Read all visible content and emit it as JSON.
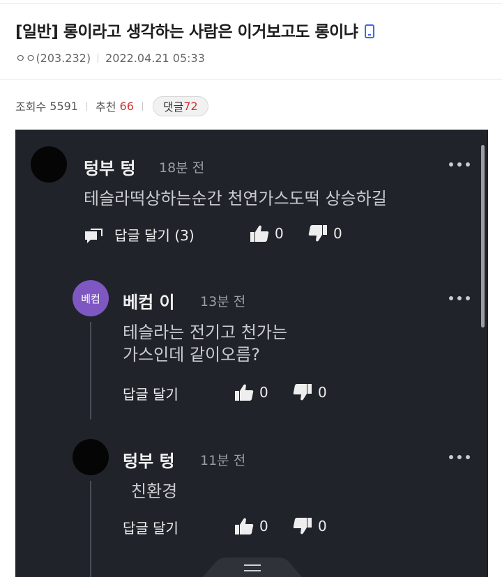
{
  "post": {
    "title": "[일반] 롱이라고 생각하는 사람은 이거보고도 롱이냐",
    "author": "ㅇㅇ(203.232)",
    "datetime": "2022.04.21 05:33",
    "views_label": "조회수",
    "views": "5591",
    "recommend_label": "추천",
    "recommend": "66",
    "comments_label": "댓글",
    "comments": "72"
  },
  "comments": [
    {
      "name": "텅부 텅",
      "time": "18분 전",
      "lines": [
        "테슬라떡상하는순간 천연가스도떡 상승하길"
      ],
      "reply_label": "답글 달기 (3)",
      "likes": "0",
      "dislikes": "0"
    },
    {
      "avatar_text": "베컴",
      "name": "베컴 이",
      "time": "13분 전",
      "lines": [
        "테슬라는 전기고 천가는",
        "가스인데 같이오름?"
      ],
      "reply_label": "답글 달기",
      "likes": "0",
      "dislikes": "0"
    },
    {
      "name": "텅부 텅",
      "time": "11분 전",
      "lines": [
        "친환경"
      ],
      "reply_label": "답글 달기",
      "likes": "0",
      "dislikes": "0"
    }
  ],
  "colors": {
    "recommend_accent": "#c73535",
    "dark_background": "#20242a",
    "avatar_purple": "#7f57c2",
    "mobile_icon": "#3d6be0"
  },
  "icons": [
    "mobile-phone-icon",
    "reply-bubble-icon",
    "thumbs-up-icon",
    "thumbs-down-icon",
    "more-options-icon",
    "collapse-handle-icon"
  ]
}
